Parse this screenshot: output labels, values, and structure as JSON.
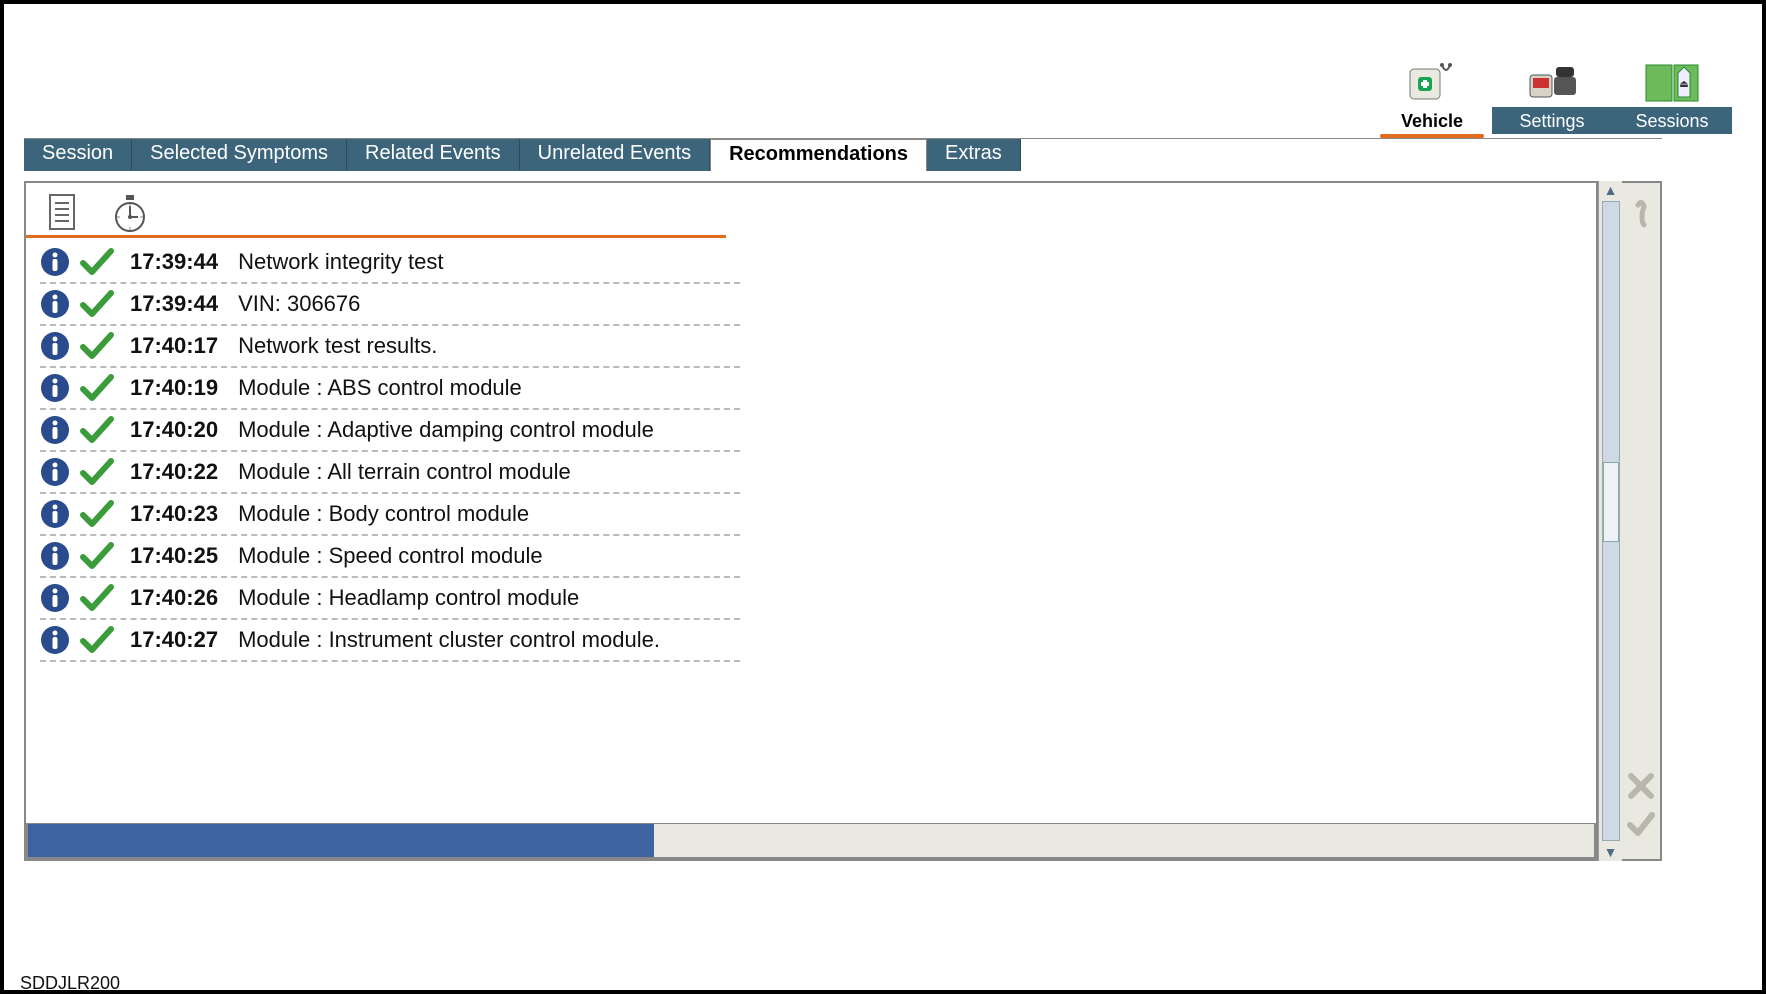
{
  "modes": {
    "vehicle": {
      "label": "Vehicle",
      "active": true
    },
    "settings": {
      "label": "Settings",
      "active": false
    },
    "sessions": {
      "label": "Sessions",
      "active": false
    }
  },
  "tabs": {
    "session": {
      "label": "Session",
      "active": false
    },
    "selected_symptoms": {
      "label": "Selected Symptoms",
      "active": false
    },
    "related_events": {
      "label": "Related Events",
      "active": false
    },
    "unrelated_events": {
      "label": "Unrelated Events",
      "active": false
    },
    "recommendations": {
      "label": "Recommendations",
      "active": true
    },
    "extras": {
      "label": "Extras",
      "active": false
    }
  },
  "log": [
    {
      "time": "17:39:44",
      "text": "Network integrity test"
    },
    {
      "time": "17:39:44",
      "text": "VIN: 306676"
    },
    {
      "time": "17:40:17",
      "text": "Network test results."
    },
    {
      "time": "17:40:19",
      "text": "Module : ABS control module"
    },
    {
      "time": "17:40:20",
      "text": "Module : Adaptive damping control module"
    },
    {
      "time": "17:40:22",
      "text": "Module : All terrain control module"
    },
    {
      "time": "17:40:23",
      "text": "Module : Body control module"
    },
    {
      "time": "17:40:25",
      "text": "Module : Speed control module"
    },
    {
      "time": "17:40:26",
      "text": "Module : Headlamp control module"
    },
    {
      "time": "17:40:27",
      "text": "Module : Instrument cluster control module."
    }
  ],
  "caption": "SDDJLR200"
}
